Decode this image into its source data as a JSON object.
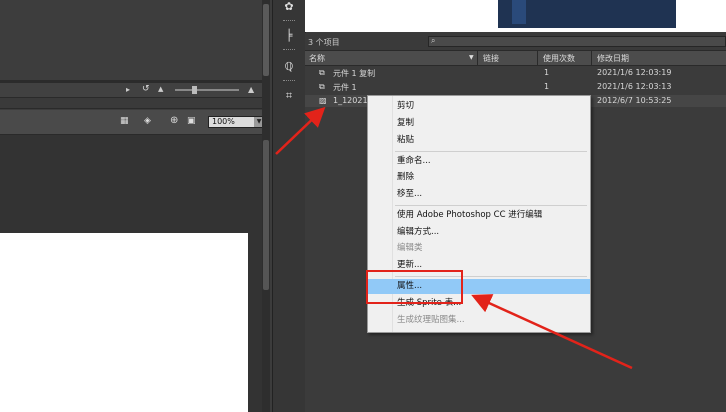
{
  "stage": {
    "zoom_value": "100%",
    "zoom_dropdown_glyph": "▼"
  },
  "library": {
    "item_count": "3 个项目",
    "columns": [
      "名称",
      "链接",
      "使用次数",
      "修改日期"
    ],
    "sort_arrow": "▼",
    "rows": [
      {
        "name": "元件 1 复制",
        "uses": "1",
        "date": "2021/1/6 12:03:19",
        "icon": "graphic-symbol-icon"
      },
      {
        "name": "元件 1",
        "uses": "1",
        "date": "2021/1/6 12:03:13",
        "icon": "graphic-symbol-icon"
      },
      {
        "name": "1_12021",
        "uses": "",
        "date": "2012/6/7 10:53:25",
        "icon": "bitmap-icon"
      }
    ]
  },
  "context_menu": {
    "items": [
      {
        "label": "剪切",
        "disabled": false
      },
      {
        "label": "复制",
        "disabled": false
      },
      {
        "label": "粘贴",
        "disabled": false
      },
      {
        "label": "重命名...",
        "disabled": false
      },
      {
        "label": "删除",
        "disabled": false
      },
      {
        "label": "移至...",
        "disabled": false
      },
      {
        "label": "使用 Adobe Photoshop CC 进行编辑",
        "disabled": false
      },
      {
        "label": "编辑方式...",
        "disabled": false
      },
      {
        "label": "编辑类",
        "disabled": true
      },
      {
        "label": "更新...",
        "disabled": false
      },
      {
        "label": "属性...",
        "disabled": false,
        "highlighted": true
      },
      {
        "label": "生成 Sprite 表...",
        "disabled": false
      },
      {
        "label": "生成纹理贴图集...",
        "disabled": true
      }
    ]
  },
  "colors": {
    "highlight": "#91c9f7",
    "annotation_red": "#e2231a"
  }
}
